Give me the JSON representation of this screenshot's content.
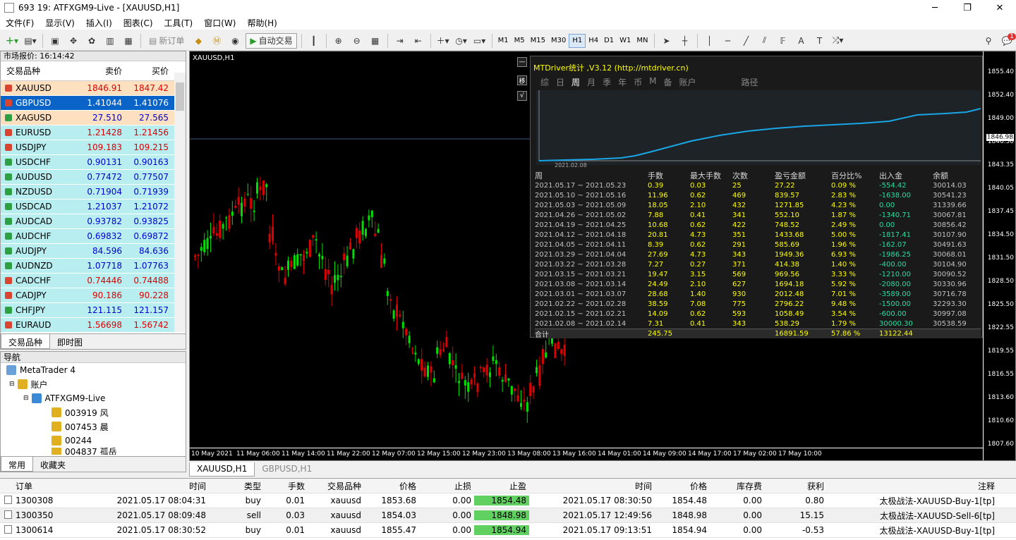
{
  "window": {
    "title": "693  19: ATFXGM9-Live - [XAUUSD,H1]"
  },
  "menu": [
    "文件(F)",
    "显示(V)",
    "插入(I)",
    "图表(C)",
    "工具(T)",
    "窗口(W)",
    "帮助(H)"
  ],
  "toolbar": {
    "new_order": "新订单",
    "auto_trade": "自动交易",
    "timeframes": [
      "M1",
      "M5",
      "M15",
      "M30",
      "H1",
      "H4",
      "D1",
      "W1",
      "MN"
    ],
    "active_tf": "H1",
    "alert_count": "1"
  },
  "market_watch": {
    "header": "市场报价: 16:14:42",
    "col_symbol": "交易品种",
    "col_bid": "卖价",
    "col_ask": "买价",
    "rows": [
      {
        "symbol": "XAUUSD",
        "bid": "1846.91",
        "ask": "1847.42",
        "dir": "down",
        "bg": "#fde0c0"
      },
      {
        "symbol": "GBPUSD",
        "bid": "1.41044",
        "ask": "1.41076",
        "dir": "down",
        "bg": "#0a64c8"
      },
      {
        "symbol": "XAGUSD",
        "bid": "27.510",
        "ask": "27.565",
        "dir": "up",
        "bg": "#fde0c0"
      },
      {
        "symbol": "EURUSD",
        "bid": "1.21428",
        "ask": "1.21456",
        "dir": "down",
        "bg": "#b8eef0"
      },
      {
        "symbol": "USDJPY",
        "bid": "109.183",
        "ask": "109.215",
        "dir": "down",
        "bg": "#b8eef0"
      },
      {
        "symbol": "USDCHF",
        "bid": "0.90131",
        "ask": "0.90163",
        "dir": "up",
        "bg": "#b8eef0"
      },
      {
        "symbol": "AUDUSD",
        "bid": "0.77472",
        "ask": "0.77507",
        "dir": "up",
        "bg": "#b8eef0"
      },
      {
        "symbol": "NZDUSD",
        "bid": "0.71904",
        "ask": "0.71939",
        "dir": "up",
        "bg": "#b8eef0"
      },
      {
        "symbol": "USDCAD",
        "bid": "1.21037",
        "ask": "1.21072",
        "dir": "up",
        "bg": "#b8eef0"
      },
      {
        "symbol": "AUDCAD",
        "bid": "0.93782",
        "ask": "0.93825",
        "dir": "up",
        "bg": "#b8eef0"
      },
      {
        "symbol": "AUDCHF",
        "bid": "0.69832",
        "ask": "0.69872",
        "dir": "up",
        "bg": "#b8eef0"
      },
      {
        "symbol": "AUDJPY",
        "bid": "84.596",
        "ask": "84.636",
        "dir": "up",
        "bg": "#b8eef0"
      },
      {
        "symbol": "AUDNZD",
        "bid": "1.07718",
        "ask": "1.07763",
        "dir": "up",
        "bg": "#b8eef0"
      },
      {
        "symbol": "CADCHF",
        "bid": "0.74446",
        "ask": "0.74488",
        "dir": "down",
        "bg": "#b8eef0"
      },
      {
        "symbol": "CADJPY",
        "bid": "90.186",
        "ask": "90.228",
        "dir": "down",
        "bg": "#b8eef0"
      },
      {
        "symbol": "CHFJPY",
        "bid": "121.115",
        "ask": "121.157",
        "dir": "up",
        "bg": "#b8eef0"
      },
      {
        "symbol": "EURAUD",
        "bid": "1.56698",
        "ask": "1.56742",
        "dir": "down",
        "bg": "#b8eef0"
      }
    ],
    "tabs": [
      "交易品种",
      "即时图"
    ]
  },
  "navigator": {
    "header": "导航",
    "items": [
      "MetaTrader 4",
      "账户",
      "ATFXGM9-Live",
      "003919  风",
      "007453  晨",
      "00244",
      "004837  孤岳"
    ],
    "tabs": [
      "常用",
      "收藏夹"
    ]
  },
  "chart": {
    "label": "XAUUSD,H1",
    "current_price": "1846.98",
    "prices": [
      "1855.40",
      "1852.40",
      "1849.00",
      "1846.30",
      "1843.35",
      "1840.05",
      "1837.45",
      "1834.50",
      "1831.50",
      "1828.50",
      "1825.50",
      "1822.55",
      "1819.55",
      "1816.55",
      "1813.60",
      "1810.60",
      "1807.60"
    ],
    "times": [
      "10 May 2021",
      "11 May 06:00",
      "11 May 14:00",
      "11 May 22:00",
      "12 May 07:00",
      "12 May 15:00",
      "12 May 23:00",
      "13 May 08:00",
      "13 May 16:00",
      "14 May 01:00",
      "14 May 09:00",
      "14 May 17:00",
      "17 May 02:00",
      "17 May 10:00"
    ]
  },
  "overlay": {
    "title": "MTDriver统计 ,V3.12 (http://mtdriver.cn)",
    "tabs": [
      "综",
      "日",
      "周",
      "月",
      "季",
      "年",
      "币",
      "M",
      "备",
      "账户",
      "路径"
    ],
    "active_tab": "周",
    "mini_label": "2021.02.08",
    "side_buttons": [
      "—",
      "移",
      "√"
    ],
    "headers": [
      "周",
      "手数",
      "最大手数",
      "次数",
      "盈亏金额",
      "百分比%",
      "出入金",
      "余额"
    ],
    "rows": [
      [
        "2021.05.17 ~ 2021.05.23",
        "0.39",
        "0.03",
        "25",
        "27.22",
        "0.09 %",
        "-554.42",
        "30014.03"
      ],
      [
        "2021.05.10 ~ 2021.05.16",
        "11.96",
        "0.62",
        "469",
        "839.57",
        "2.83 %",
        "-1638.00",
        "30541.23"
      ],
      [
        "2021.05.03 ~ 2021.05.09",
        "18.05",
        "2.10",
        "432",
        "1271.85",
        "4.23 %",
        "0.00",
        "31339.66"
      ],
      [
        "2021.04.26 ~ 2021.05.02",
        "7.88",
        "0.41",
        "341",
        "552.10",
        "1.87 %",
        "-1340.71",
        "30067.81"
      ],
      [
        "2021.04.19 ~ 2021.04.25",
        "10.68",
        "0.62",
        "422",
        "748.52",
        "2.49 %",
        "0.00",
        "30856.42"
      ],
      [
        "2021.04.12 ~ 2021.04.18",
        "20.81",
        "4.73",
        "351",
        "1433.68",
        "5.00 %",
        "-1817.41",
        "30107.90"
      ],
      [
        "2021.04.05 ~ 2021.04.11",
        "8.39",
        "0.62",
        "291",
        "585.69",
        "1.96 %",
        "-162.07",
        "30491.63"
      ],
      [
        "2021.03.29 ~ 2021.04.04",
        "27.69",
        "4.73",
        "343",
        "1949.36",
        "6.93 %",
        "-1986.25",
        "30068.01"
      ],
      [
        "2021.03.22 ~ 2021.03.28",
        "7.27",
        "0.27",
        "371",
        "414.38",
        "1.40 %",
        "-400.00",
        "30104.90"
      ],
      [
        "2021.03.15 ~ 2021.03.21",
        "19.47",
        "3.15",
        "569",
        "969.56",
        "3.33 %",
        "-1210.00",
        "30090.52"
      ],
      [
        "2021.03.08 ~ 2021.03.14",
        "24.49",
        "2.10",
        "627",
        "1694.18",
        "5.92 %",
        "-2080.00",
        "30330.96"
      ],
      [
        "2021.03.01 ~ 2021.03.07",
        "28.68",
        "1.40",
        "930",
        "2012.48",
        "7.01 %",
        "-3589.00",
        "30716.78"
      ],
      [
        "2021.02.22 ~ 2021.02.28",
        "38.59",
        "7.08",
        "775",
        "2796.22",
        "9.48 %",
        "-1500.00",
        "32293.30"
      ],
      [
        "2021.02.15 ~ 2021.02.21",
        "14.09",
        "0.62",
        "593",
        "1058.49",
        "3.54 %",
        "-600.00",
        "30997.08"
      ],
      [
        "2021.02.08 ~ 2021.02.14",
        "7.31",
        "0.41",
        "343",
        "538.29",
        "1.79 %",
        "30000.30",
        "30538.59"
      ]
    ],
    "total": {
      "label": "合计",
      "lots": "245.75",
      "pnl": "16891.59",
      "pct": "57.86 %",
      "flow": "13122.44"
    }
  },
  "chart_tabs": [
    "XAUUSD,H1",
    "GBPUSD,H1"
  ],
  "terminal": {
    "headers": [
      "订单",
      "时间",
      "类型",
      "手数",
      "交易品种",
      "价格",
      "止损",
      "止盈",
      "时间",
      "价格",
      "库存费",
      "获利",
      "注释"
    ],
    "rows": [
      [
        "1300308",
        "2021.05.17 08:04:31",
        "buy",
        "0.01",
        "xauusd",
        "1853.68",
        "0.00",
        "1854.48",
        "2021.05.17 08:30:50",
        "1854.48",
        "0.00",
        "0.80",
        "太极战法-XAUUSD-Buy-1[tp]"
      ],
      [
        "1300350",
        "2021.05.17 08:09:48",
        "sell",
        "0.03",
        "xauusd",
        "1854.03",
        "0.00",
        "1848.98",
        "2021.05.17 12:49:56",
        "1848.98",
        "0.00",
        "15.15",
        "太极战法-XAUUSD-Sell-6[tp]"
      ],
      [
        "1300614",
        "2021.05.17 08:30:52",
        "buy",
        "0.01",
        "xauusd",
        "1855.47",
        "0.00",
        "1854.94",
        "2021.05.17 09:13:51",
        "1854.94",
        "0.00",
        "-0.53",
        "太极战法-XAUUSD-Buy-1[tp]"
      ]
    ]
  }
}
